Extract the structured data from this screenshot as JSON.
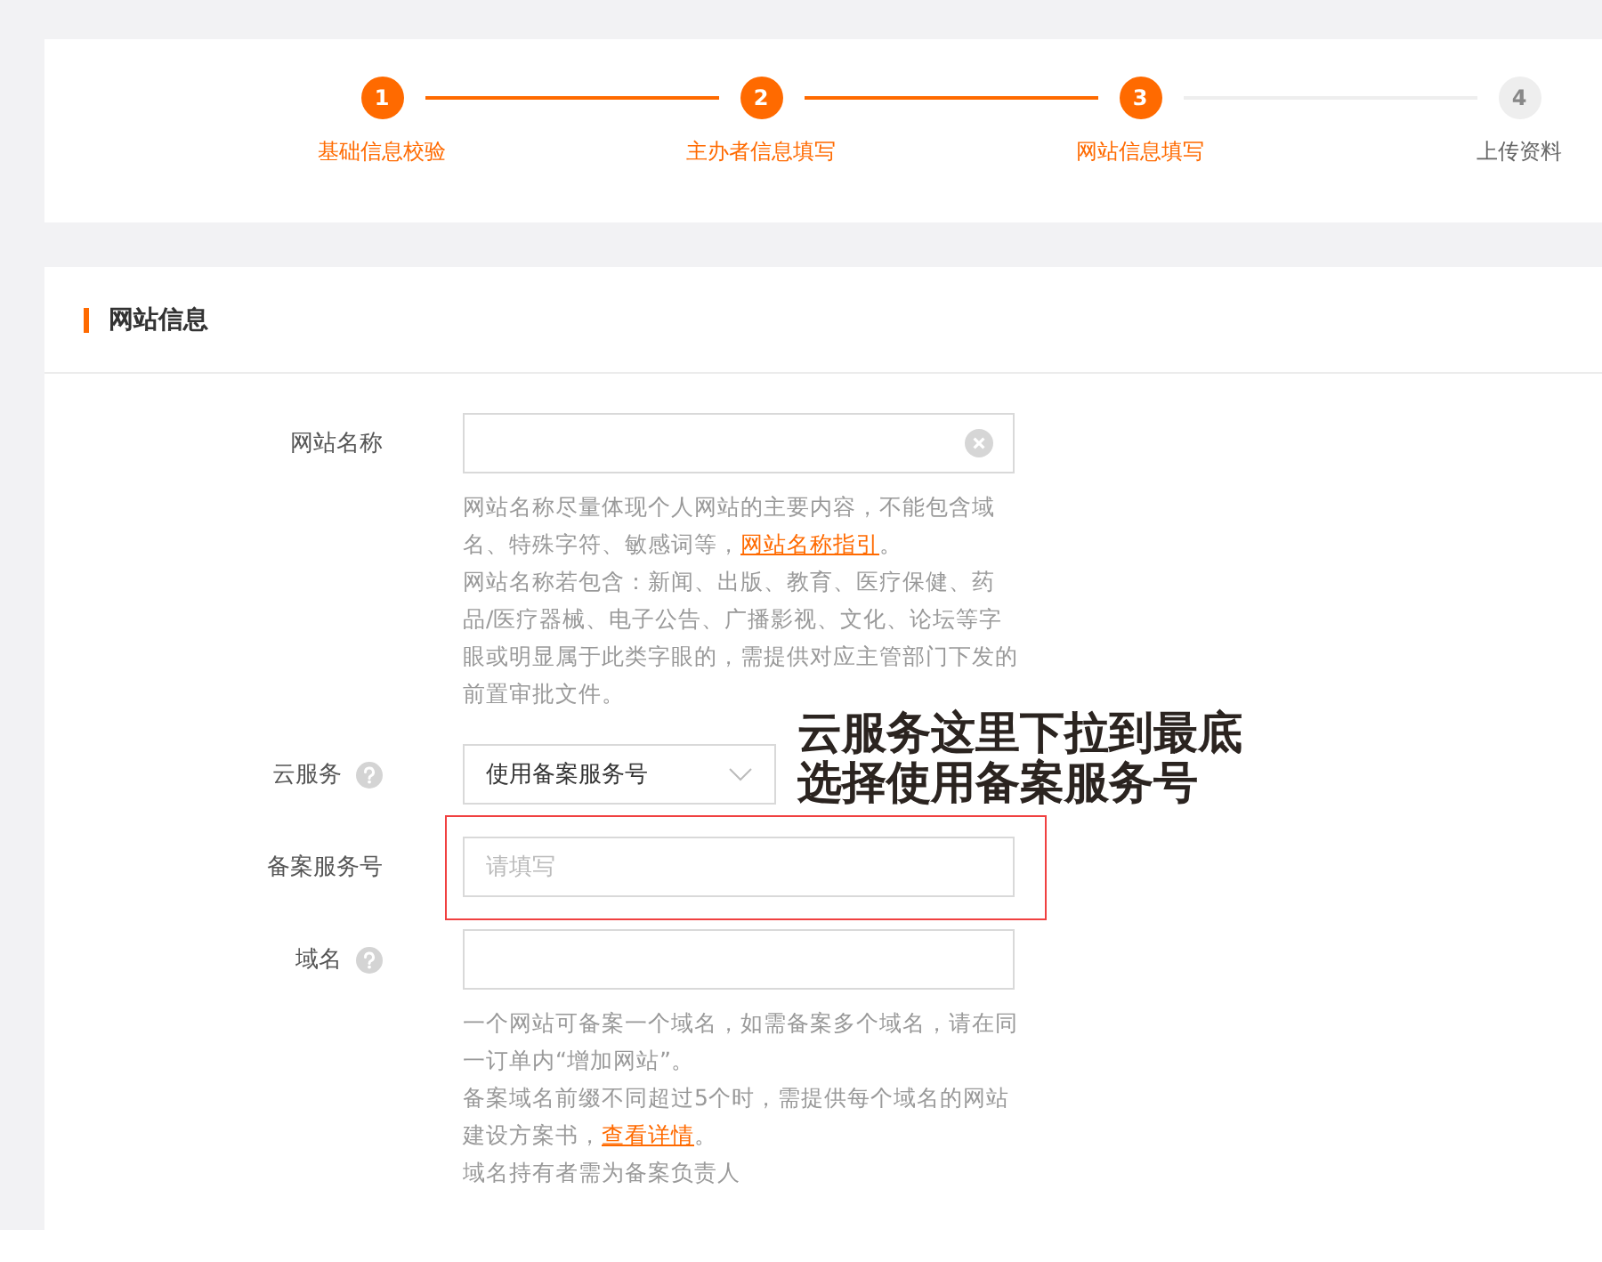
{
  "steps": [
    {
      "number": "1",
      "label": "基础信息校验",
      "active": true
    },
    {
      "number": "2",
      "label": "主办者信息填写",
      "active": true
    },
    {
      "number": "3",
      "label": "网站信息填写",
      "active": true
    },
    {
      "number": "4",
      "label": "上传资料",
      "active": false
    }
  ],
  "section": {
    "title": "网站信息"
  },
  "fields": [
    {
      "label": "网站名称",
      "kind": "text",
      "clearable": true,
      "hints": [
        {
          "before": "网站名称尽量体现个人网站的主要内容，不能包含域名、特殊字符、敏感词等，",
          "link": "网站名称指引",
          "after": "。"
        },
        {
          "before": "网站名称若包含：新闻、出版、教育、医疗保健、药品/医疗器械、电子公告、广播影视、文化、论坛等字眼或明显属于此类字眼的，需提供对应主管部门下发的前置审批文件。"
        }
      ]
    },
    {
      "label": "云服务",
      "help": true,
      "kind": "select",
      "value": "使用备案服务号"
    },
    {
      "label": "备案服务号",
      "kind": "text",
      "placeholder": "请填写",
      "highlighted": true
    },
    {
      "label": "域名",
      "help": true,
      "kind": "text",
      "hints": [
        {
          "before": "一个网站可备案一个域名，如需备案多个域名，请在同一订单内“增加网站”。"
        },
        {
          "before": "备案域名前缀不同超过5个时，需提供每个域名的网站建设方案书，",
          "link": "查看详情",
          "after": "。"
        },
        {
          "before": "域名持有者需为备案负责人"
        }
      ]
    }
  ],
  "annotation": {
    "lines": [
      "云服务这里下拉到最底",
      "选择使用备案服务号"
    ]
  }
}
